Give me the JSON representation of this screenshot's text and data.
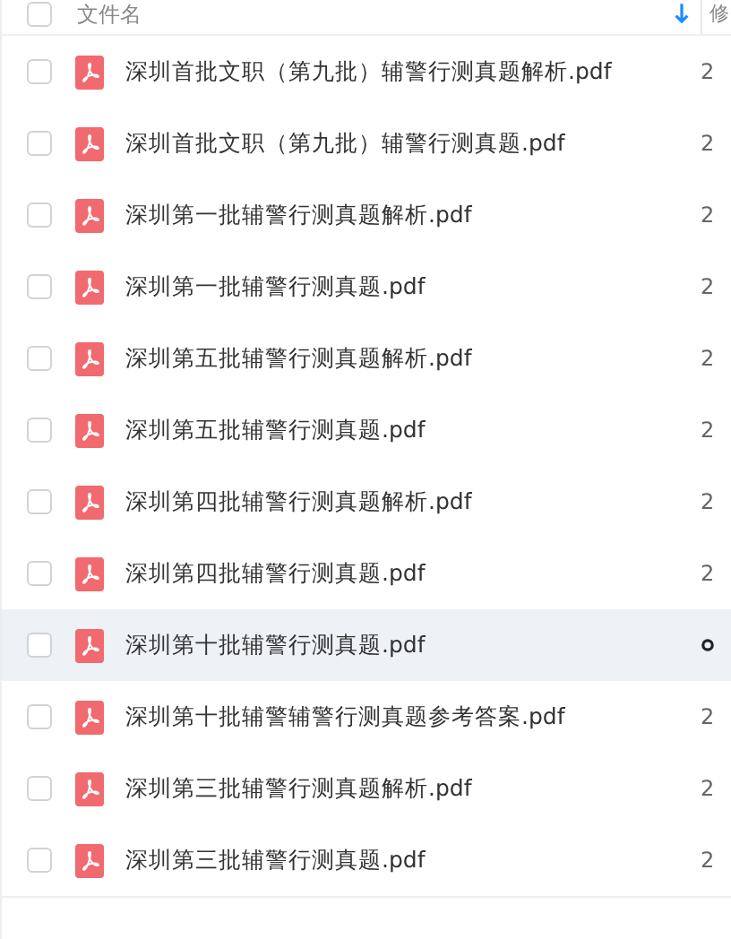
{
  "table": {
    "all_checked": false,
    "columns": [
      {
        "label": "文件名",
        "sorted": true
      },
      {
        "label": "修"
      }
    ],
    "rows": [
      {
        "name": "深圳首批文职（第九批）辅警行测真题解析.pdf",
        "column_2": "2",
        "checked": false,
        "hovered": false
      },
      {
        "name": "深圳首批文职（第九批）辅警行测真题.pdf",
        "column_2": "2",
        "checked": false,
        "hovered": false
      },
      {
        "name": "深圳第一批辅警行测真题解析.pdf",
        "column_2": "2",
        "checked": false,
        "hovered": false
      },
      {
        "name": "深圳第一批辅警行测真题.pdf",
        "column_2": "2",
        "checked": false,
        "hovered": false
      },
      {
        "name": "深圳第五批辅警行测真题解析.pdf",
        "column_2": "2",
        "checked": false,
        "hovered": false
      },
      {
        "name": "深圳第五批辅警行测真题.pdf",
        "column_2": "2",
        "checked": false,
        "hovered": false
      },
      {
        "name": "深圳第四批辅警行测真题解析.pdf",
        "column_2": "2",
        "checked": false,
        "hovered": false
      },
      {
        "name": "深圳第四批辅警行测真题.pdf",
        "column_2": "2",
        "checked": false,
        "hovered": false
      },
      {
        "name": "深圳第十批辅警行测真题.pdf",
        "checked": false,
        "hovered": true
      },
      {
        "name": "深圳第十批辅警辅警行测真题参考答案.pdf",
        "column_2": "2",
        "checked": false,
        "hovered": false
      },
      {
        "name": "深圳第三批辅警行测真题解析.pdf",
        "column_2": "2",
        "checked": false,
        "hovered": false
      },
      {
        "name": "深圳第三批辅警行测真题.pdf",
        "column_2": "2",
        "checked": false,
        "hovered": false
      }
    ]
  }
}
